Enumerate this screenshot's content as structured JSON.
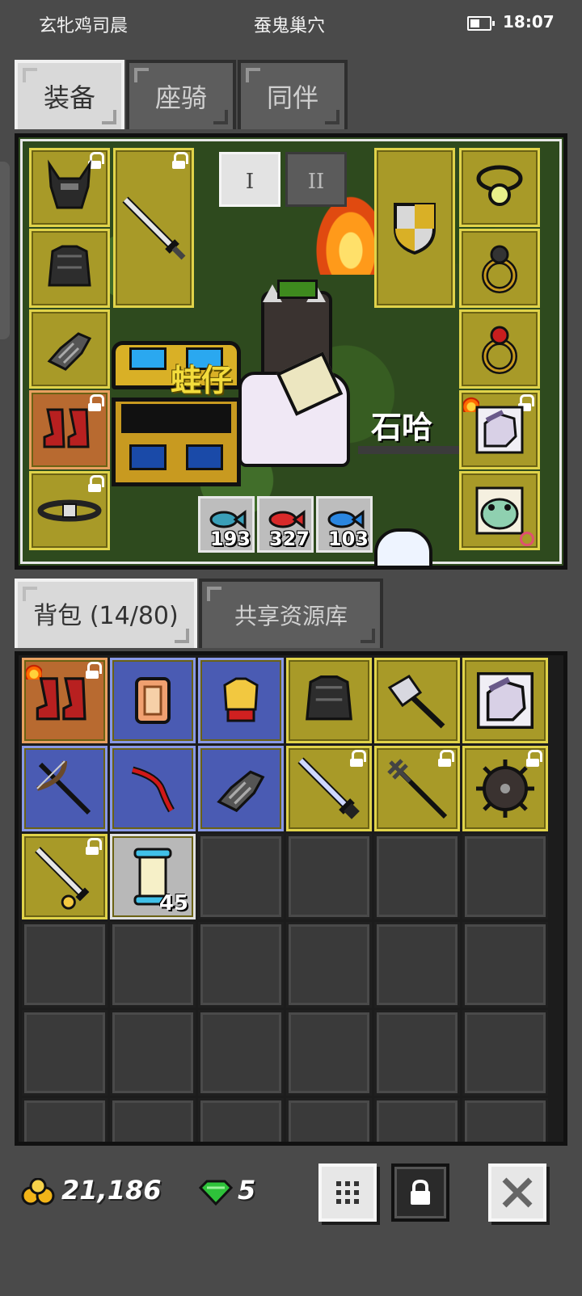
{
  "status_bar": {
    "left_text": "玄牝鸡司晨",
    "center_text": "蚕鬼巢穴",
    "time": "18:07",
    "battery_level": 0.5
  },
  "top_tabs": [
    {
      "label": "装备",
      "active": true
    },
    {
      "label": "座骑",
      "active": false
    },
    {
      "label": "同伴",
      "active": false
    }
  ],
  "equip": {
    "set_tabs": [
      {
        "label": "I",
        "active": true
      },
      {
        "label": "II",
        "active": false
      }
    ],
    "pet_name": "蛙仔",
    "character_name": "石哈",
    "left_slots": [
      {
        "name": "helmet-slot",
        "icon": "horned-helmet-icon",
        "locked": true,
        "rarity": "gold"
      },
      {
        "name": "armor-slot",
        "icon": "dark-armor-icon",
        "locked": false,
        "rarity": "gold"
      },
      {
        "name": "gloves-slot",
        "icon": "gauntlet-icon",
        "locked": false,
        "rarity": "gold"
      },
      {
        "name": "boots-slot",
        "icon": "red-boots-icon",
        "locked": true,
        "rarity": "orange"
      },
      {
        "name": "belt-slot",
        "icon": "belt-icon",
        "locked": true,
        "rarity": "gold"
      }
    ],
    "weapon_slot": {
      "icon": "sword-icon",
      "locked": true
    },
    "offhand_slot": {
      "icon": "shield-icon",
      "locked": false
    },
    "right_slots": [
      {
        "name": "amulet-slot",
        "icon": "amulet-icon",
        "locked": false
      },
      {
        "name": "ring-slot-1",
        "icon": "ring-icon",
        "locked": false
      },
      {
        "name": "ring-slot-2",
        "icon": "ruby-ring-icon",
        "locked": false
      },
      {
        "name": "mount-card-slot",
        "icon": "horse-portrait-icon",
        "locked": true
      },
      {
        "name": "pet-card-slot",
        "icon": "frog-portrait-icon",
        "locked": false
      }
    ],
    "resources": [
      {
        "icon": "blue-fish-icon",
        "value": "193"
      },
      {
        "icon": "red-fish-icon",
        "value": "327"
      },
      {
        "icon": "cyan-fish-icon",
        "value": "103"
      }
    ]
  },
  "inventory_tabs": [
    {
      "label": "背包 (14/80)",
      "active": true
    },
    {
      "label": "共享资源库",
      "active": false
    }
  ],
  "inventory": {
    "columns": 6,
    "items": [
      {
        "icon": "red-boots-icon",
        "rarity": "orange",
        "locked": true,
        "flame": true,
        "count": ""
      },
      {
        "icon": "scroll-icon",
        "rarity": "blue",
        "locked": false,
        "count": ""
      },
      {
        "icon": "gold-armor-icon",
        "rarity": "blue",
        "locked": false,
        "count": ""
      },
      {
        "icon": "dark-armor-icon",
        "rarity": "gold",
        "locked": false,
        "count": ""
      },
      {
        "icon": "axe-icon",
        "rarity": "gold",
        "locked": false,
        "count": ""
      },
      {
        "icon": "horse-portrait-icon",
        "rarity": "gold",
        "locked": false,
        "count": ""
      },
      {
        "icon": "crossbow-icon",
        "rarity": "blue",
        "locked": false,
        "count": ""
      },
      {
        "icon": "red-bow-icon",
        "rarity": "blue",
        "locked": false,
        "count": ""
      },
      {
        "icon": "gauntlet-icon",
        "rarity": "blue",
        "locked": false,
        "count": ""
      },
      {
        "icon": "greatsword-icon",
        "rarity": "gold",
        "locked": true,
        "count": ""
      },
      {
        "icon": "trident-icon",
        "rarity": "gold",
        "locked": true,
        "count": ""
      },
      {
        "icon": "spiked-shield-icon",
        "rarity": "gold",
        "locked": true,
        "count": ""
      },
      {
        "icon": "sword-icon",
        "rarity": "gold",
        "locked": true,
        "count": ""
      },
      {
        "icon": "scroll-bundle-icon",
        "rarity": "grey",
        "locked": false,
        "count": "45"
      }
    ],
    "empty_slot_count": 22
  },
  "bottom_bar": {
    "gold": "21,186",
    "gems": "5",
    "buttons": [
      {
        "name": "grid-view-button",
        "icon": "grid-icon"
      },
      {
        "name": "lock-mode-button",
        "icon": "lock-icon"
      },
      {
        "name": "close-button",
        "icon": "close-icon"
      }
    ],
    "colors": {
      "gold": "#f2b418",
      "gem": "#2ec23a"
    }
  }
}
